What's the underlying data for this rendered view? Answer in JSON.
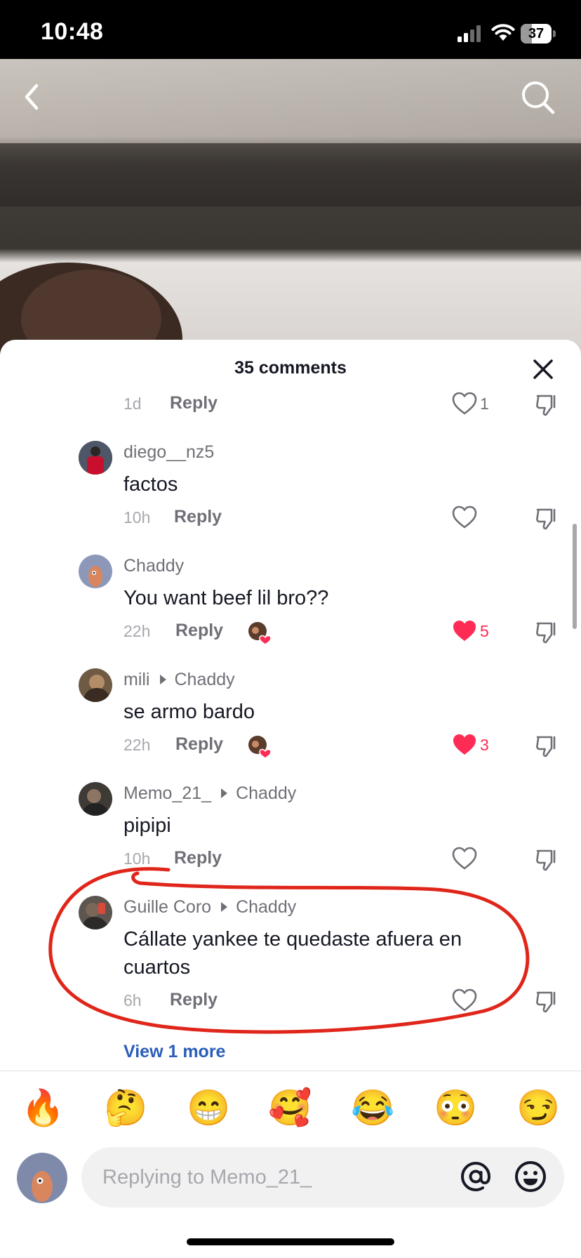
{
  "status_bar": {
    "time": "10:48",
    "battery": "37",
    "battery_level": 0.37
  },
  "sheet": {
    "title": "35 comments"
  },
  "comments": [
    {
      "username": "",
      "reply_to": "",
      "text": "",
      "time": "1d",
      "reply_label": "Reply",
      "likes": "1",
      "liked": false,
      "creator_liked": false
    },
    {
      "username": "diego__nz5",
      "reply_to": "",
      "text": "factos",
      "time": "10h",
      "reply_label": "Reply",
      "likes": "",
      "liked": false,
      "creator_liked": false
    },
    {
      "username": "Chaddy",
      "reply_to": "",
      "text": "You want beef lil bro??",
      "time": "22h",
      "reply_label": "Reply",
      "likes": "5",
      "liked": true,
      "creator_liked": true
    },
    {
      "username": "mili",
      "reply_to": "Chaddy",
      "text": "se armo bardo",
      "time": "22h",
      "reply_label": "Reply",
      "likes": "3",
      "liked": true,
      "creator_liked": true
    },
    {
      "username": "Memo_21_",
      "reply_to": "Chaddy",
      "text": "pipipi",
      "time": "10h",
      "reply_label": "Reply",
      "likes": "",
      "liked": false,
      "creator_liked": false
    },
    {
      "username": "Guille Coro",
      "reply_to": "Chaddy",
      "text": "Cállate yankee te quedaste afuera en cuartos",
      "time": "6h",
      "reply_label": "Reply",
      "likes": "",
      "liked": false,
      "creator_liked": false
    }
  ],
  "view_more": "View 1 more",
  "quick_emojis": [
    "🔥",
    "🤔",
    "😁",
    "🥰",
    "😂",
    "😳",
    "😏"
  ],
  "input": {
    "placeholder": "Replying to Memo_21_"
  },
  "colors": {
    "accent_red": "#fe2c55",
    "link_blue": "#2b5db9",
    "annotation_red": "#e0261b"
  },
  "icons": {
    "back": "chevron-left-icon",
    "search": "search-icon",
    "close": "close-icon",
    "heart": "heart-icon",
    "dislike": "thumbs-down-icon",
    "mention": "at-icon",
    "emoji": "smiley-icon"
  }
}
